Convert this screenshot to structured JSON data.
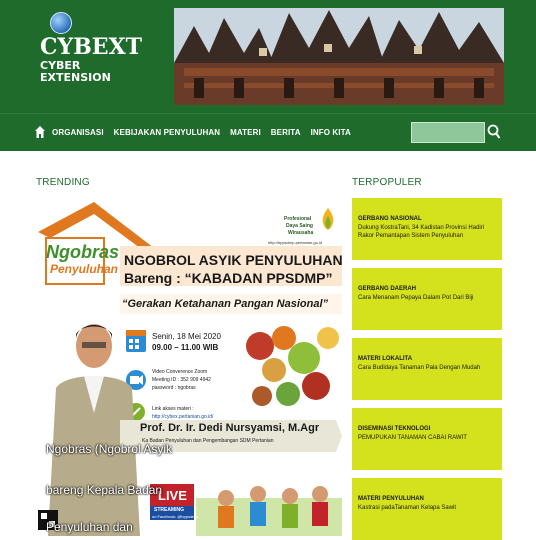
{
  "header": {
    "logo_main": "CYBEXT",
    "logo_sub": "CYBER EXTENSION"
  },
  "nav": {
    "items": [
      "ORGANISASI",
      "KEBIJAKAN PENYULUHAN",
      "MATERI",
      "BERITA",
      "INFO KITA"
    ]
  },
  "trending": {
    "title": "TRENDING",
    "poster": {
      "logo_line1": "Ngobras",
      "logo_line2": "Penyuluhan",
      "brand_line1": "Profesional",
      "brand_line2": "Daya Saing",
      "brand_line3": "Wirausaha",
      "site": "http://bppsdmp.pertanian.go.id",
      "headline1": "NGOBROL ASYIK PENYULUHAN",
      "headline2": "Bareng : “KABADAN PPSDMP”",
      "tagline": "“Gerakan Ketahanan Pangan Nasional”",
      "date": "Senin, 18 Mei 2020",
      "time": "09.00 – 11.00 WIB",
      "zoom_title": "Video Converence Zoom",
      "meeting_id": "Meeting ID : 352 909 4942",
      "password": "password  : ngobras",
      "link_label": "Link akses materi :",
      "link_url": "http://cybex.pertanian.go.id/",
      "speaker": "Prof. Dr. Ir. Dedi Nursyamsi, M.Agr",
      "speaker_role": "Ka Badan Penyuluhan dan Pengembangan SDM Pertanian",
      "live_label": "LIVE",
      "live_sub": "STREAMING",
      "live_fb": "on Facebook: @bppsdmp",
      "caption1": "Ngobras (Ngobrol Asyik",
      "caption2": "bareng Kepala Badan",
      "caption3": "Penyuluhan dan"
    }
  },
  "popular": {
    "title": "TERPOPULER",
    "cards": [
      {
        "category": "GERBANG NASIONAL",
        "text": "Dukung KostraTani, 34 Kadistan Provinsi Hadiri Rakor Pemantapan Sistem Penyuluhan"
      },
      {
        "category": "GERBANG DAERAH",
        "text": "Cara Menanam Pepaya Dalam Pot Dari Biji"
      },
      {
        "category": "MATERI LOKALITA",
        "text": "Cara Budidaya Tanaman Pala Dengan Mudah"
      },
      {
        "category": "DISEMINASI TEKNOLOGI",
        "text": "PEMUPUKAN TANAMAN CABAI RAWIT"
      },
      {
        "category": "MATERI PENYULUHAN",
        "text": "Kastrasi padaTanaman Kelapa Sawit"
      }
    ]
  },
  "colors": {
    "header_green": "#1f6b2c",
    "card_yellow": "#d4e11d",
    "poster_orange": "#e0781f"
  },
  "icons": {
    "home": "home-icon",
    "search": "search-icon",
    "calendar": "calendar-icon",
    "video": "video-camera-icon",
    "link": "link-icon"
  }
}
